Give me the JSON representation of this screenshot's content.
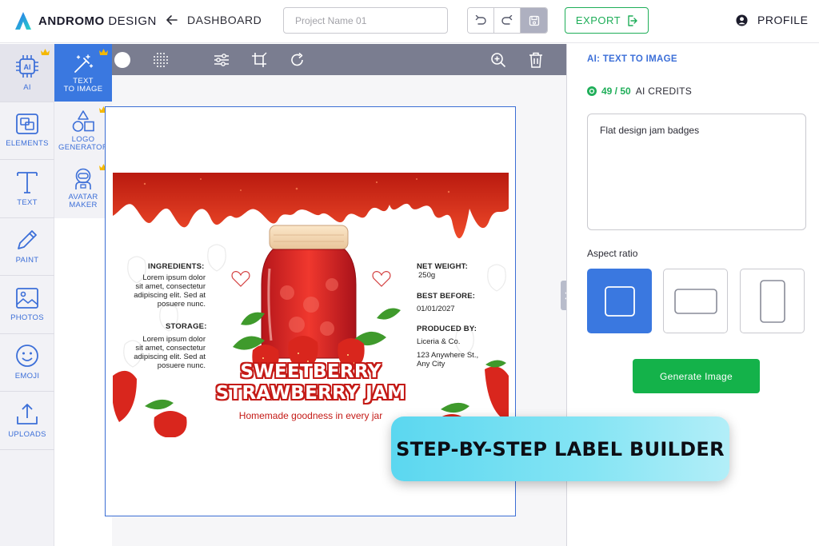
{
  "header": {
    "logo_bold": "ANDROMO",
    "logo_rest": " DESIGN",
    "back_label": "DASHBOARD",
    "project_placeholder": "Project Name 01",
    "export_label": "EXPORT",
    "profile_label": "PROFILE"
  },
  "sidebar": {
    "items": [
      {
        "label": "AI",
        "icon": "ai-chip-icon"
      },
      {
        "label": "ELEMENTS",
        "icon": "elements-icon"
      },
      {
        "label": "TEXT",
        "icon": "text-icon"
      },
      {
        "label": "PAINT",
        "icon": "pencil-icon"
      },
      {
        "label": "PHOTOS",
        "icon": "image-icon"
      },
      {
        "label": "EMOJI",
        "icon": "smiley-icon"
      },
      {
        "label": "UPLOADS",
        "icon": "upload-icon"
      }
    ]
  },
  "subpanel": {
    "items": [
      {
        "label_1": "TEXT",
        "label_2": "TO IMAGE",
        "icon": "magic-wand-icon"
      },
      {
        "label_1": "LOGO",
        "label_2": "GENERATOR",
        "icon": "shapes-icon"
      },
      {
        "label_1": "AVATAR",
        "label_2": "MAKER",
        "icon": "astronaut-icon"
      }
    ]
  },
  "label": {
    "ingredients_head": "INGREDIENTS:",
    "ingredients_body": [
      "Lorem ipsum dolor",
      "sit amet, consectetur",
      "adipiscing elit. Sed at",
      "posuere nunc."
    ],
    "storage_head": "STORAGE:",
    "storage_body": [
      "Lorem ipsum dolor",
      "sit amet, consectetur",
      "adipiscing elit. Sed at",
      "posuere nunc."
    ],
    "net_weight_head": "NET WEIGHT:",
    "net_weight": "250g",
    "best_before_head": "BEST BEFORE:",
    "best_before": "01/01/2027",
    "produced_by_head": "PRODUCED BY:",
    "producer": "Liceria & Co.",
    "address": [
      "123 Anywhere St.,",
      "Any City"
    ],
    "title_1": "SWEETBERRY",
    "title_2": "STRAWBERRY JAM",
    "tagline": "Homemade goodness in every jar"
  },
  "rightpanel": {
    "title": "AI: TEXT TO IMAGE",
    "credits_count": "49 / 50",
    "credits_label": "AI CREDITS",
    "prompt_value": "Flat design jam badges",
    "aspect_label": "Aspect ratio",
    "generate_label": "Generate Image"
  },
  "banner": {
    "text": "STEP-BY-STEP LABEL BUILDER"
  },
  "colors": {
    "accent": "#3a78e0",
    "green": "#14b24a",
    "toolbar": "#7a7d90"
  }
}
